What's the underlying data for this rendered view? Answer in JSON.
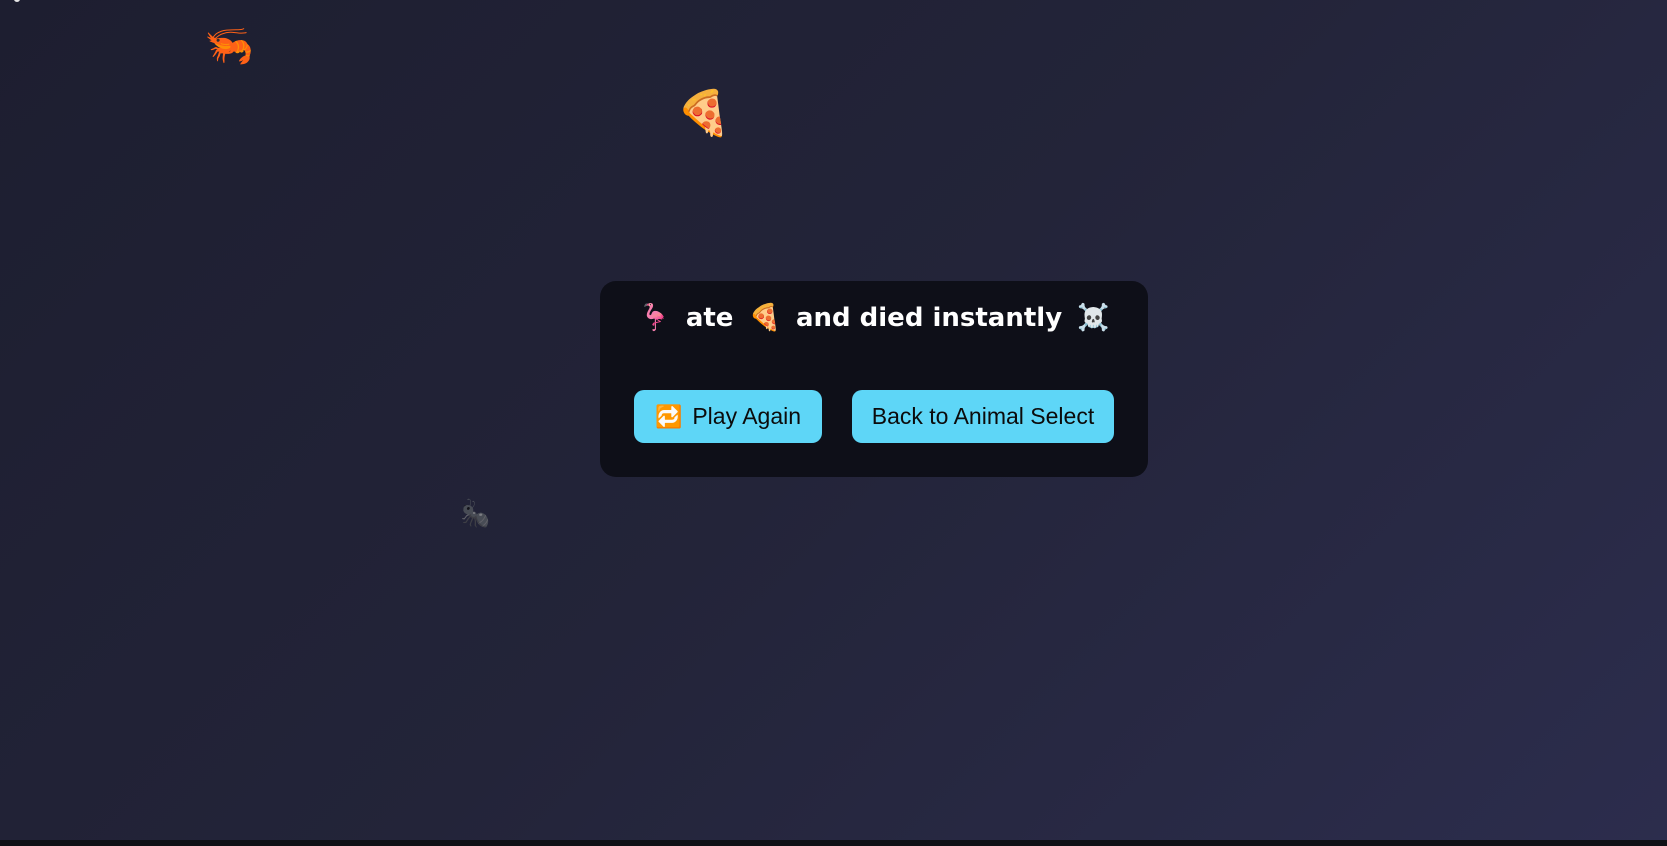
{
  "game": {
    "sprites": {
      "shrimp": "🦐",
      "pizza": "🍕",
      "ant": "🐜"
    }
  },
  "death_modal": {
    "message": {
      "animal": "🦩",
      "verb": "ate",
      "food": "🍕",
      "outcome": "and died instantly",
      "skull": "☠️"
    },
    "play_again": {
      "icon": "🔁",
      "label": "Play Again"
    },
    "back_to_select": {
      "label": "Back to Animal Select"
    }
  },
  "colors": {
    "button": "#5ed6f7",
    "modal_background": "#0e0f18",
    "page_background": "#23243a"
  }
}
